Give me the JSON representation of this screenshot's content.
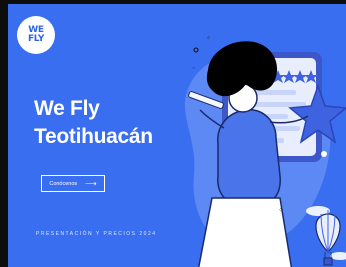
{
  "logo": {
    "text": "WE\nFLY"
  },
  "hero": {
    "title_line1": "We Fly",
    "title_line2": "Teotihuacán",
    "button_label": "Conócenos",
    "button_arrow": "⟶",
    "subtitle": "PRESENTACIÓN Y PRECIOS 2024"
  },
  "colors": {
    "background": "#3a6ef0",
    "text": "#ffffff",
    "frame": "#0d0d0d"
  },
  "icons": [
    "arrow-right-icon",
    "hot-air-balloon-icon",
    "star-icon",
    "pencil-icon"
  ]
}
